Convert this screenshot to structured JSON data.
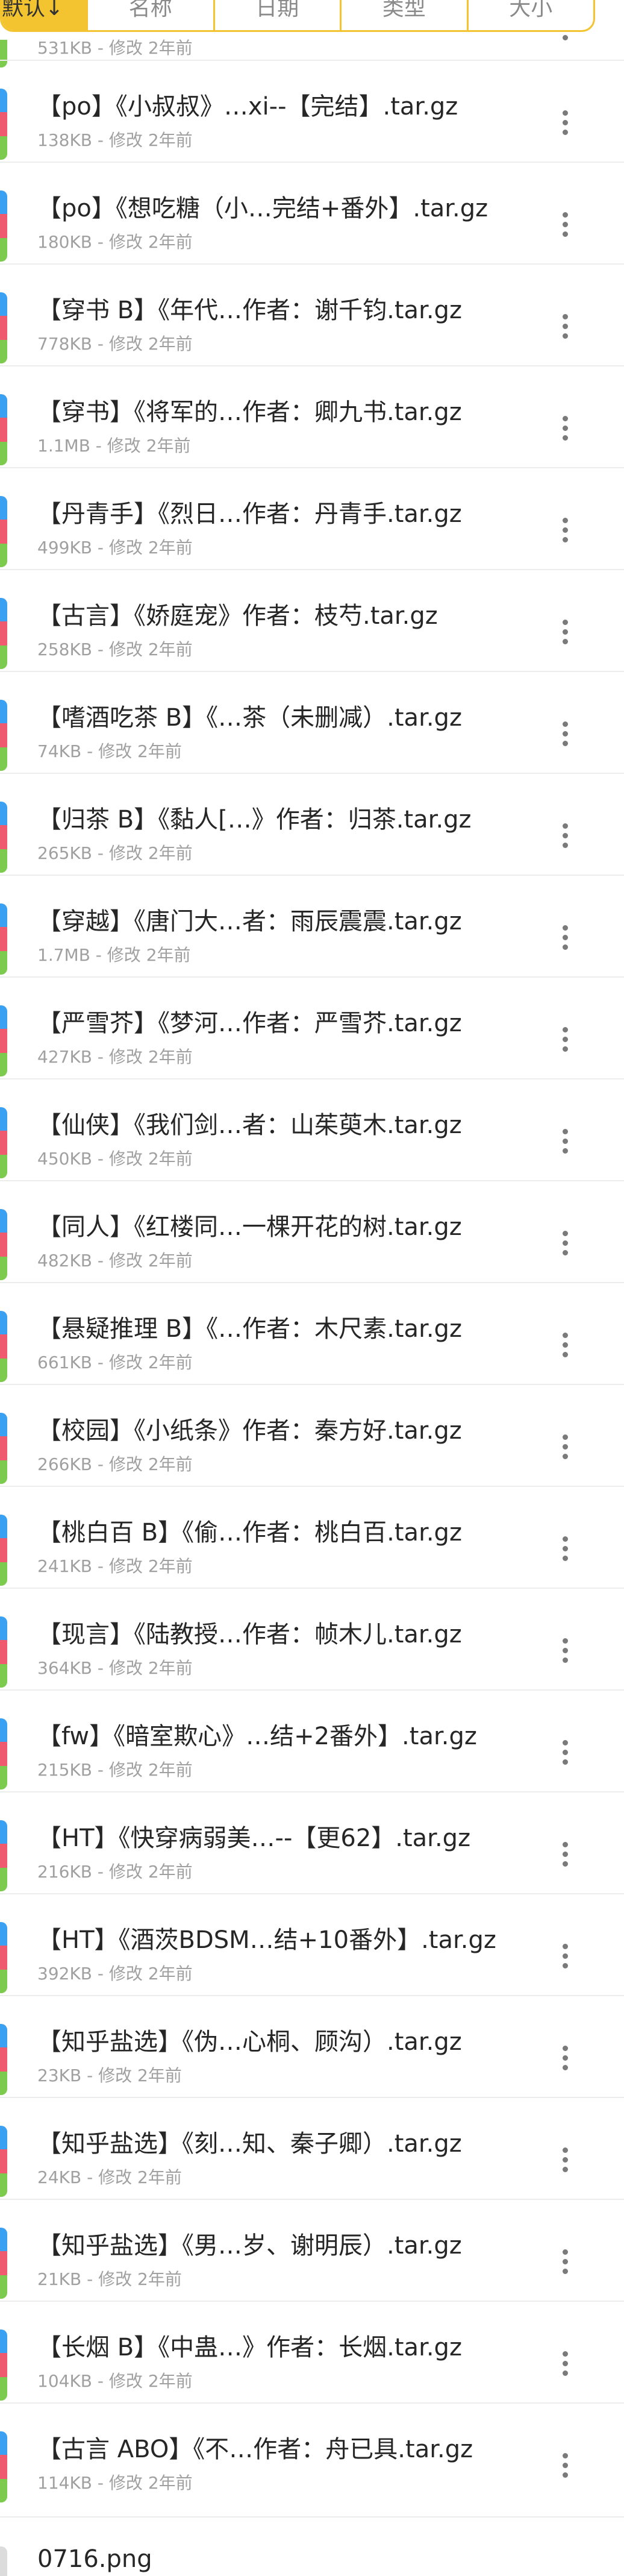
{
  "sort_tabs": [
    {
      "label": "默认↓",
      "active": true
    },
    {
      "label": "名称",
      "active": false
    },
    {
      "label": "日期",
      "active": false
    },
    {
      "label": "类型",
      "active": false
    },
    {
      "label": "大小",
      "active": false
    }
  ],
  "partial_top_item": {
    "meta": "531KB - 修改 2年前"
  },
  "files": [
    {
      "name": "【po】《小叔叔》…xi--【完结】.tar.gz",
      "meta": "138KB - 修改 2年前"
    },
    {
      "name": "【po】《想吃糖（小…完结+番外】.tar.gz",
      "meta": "180KB - 修改 2年前"
    },
    {
      "name": "【穿书 B】《年代…作者：谢千钧.tar.gz",
      "meta": "778KB - 修改 2年前"
    },
    {
      "name": "【穿书】《将军的…作者：卿九书.tar.gz",
      "meta": "1.1MB - 修改 2年前"
    },
    {
      "name": "【丹青手】《烈日…作者：丹青手.tar.gz",
      "meta": "499KB - 修改 2年前"
    },
    {
      "name": "【古言】《娇庭宠》作者：枝芍.tar.gz",
      "meta": "258KB - 修改 2年前"
    },
    {
      "name": "【嗜酒吃茶 B】《…茶（未删减）.tar.gz",
      "meta": "74KB - 修改 2年前"
    },
    {
      "name": "【归茶 B】《黏人[…》作者：归茶.tar.gz",
      "meta": "265KB - 修改 2年前"
    },
    {
      "name": "【穿越】《唐门大…者：雨辰震震.tar.gz",
      "meta": "1.7MB - 修改 2年前"
    },
    {
      "name": "【严雪芥】《梦河…作者：严雪芥.tar.gz",
      "meta": "427KB - 修改 2年前"
    },
    {
      "name": "【仙侠】《我们剑…者：山茱萸木.tar.gz",
      "meta": "450KB - 修改 2年前"
    },
    {
      "name": "【同人】《红楼同…一棵开花的树.tar.gz",
      "meta": "482KB - 修改 2年前"
    },
    {
      "name": "【悬疑推理 B】《…作者：木尺素.tar.gz",
      "meta": "661KB - 修改 2年前"
    },
    {
      "name": "【校园】《小纸条》作者：秦方好.tar.gz",
      "meta": "266KB - 修改 2年前"
    },
    {
      "name": "【桃白百 B】《偷…作者：桃白百.tar.gz",
      "meta": "241KB - 修改 2年前"
    },
    {
      "name": "【现言】《陆教授…作者：帧木儿.tar.gz",
      "meta": "364KB - 修改 2年前"
    },
    {
      "name": "【fw】《暗室欺心》…结+2番外】.tar.gz",
      "meta": "215KB - 修改 2年前"
    },
    {
      "name": "【HT】《快穿病弱美…--【更62】.tar.gz",
      "meta": "216KB - 修改 2年前"
    },
    {
      "name": "【HT】《酒茨BDSM…结+10番外】.tar.gz",
      "meta": "392KB - 修改 2年前"
    },
    {
      "name": "【知乎盐选】《伪…心桐、顾沟）.tar.gz",
      "meta": "23KB - 修改 2年前"
    },
    {
      "name": "【知乎盐选】《刻…知、秦子卿）.tar.gz",
      "meta": "24KB - 修改 2年前"
    },
    {
      "name": "【知乎盐选】《男…岁、谢明辰）.tar.gz",
      "meta": "21KB - 修改 2年前"
    },
    {
      "name": "【长烟 B】《中蛊…》作者：长烟.tar.gz",
      "meta": "104KB - 修改 2年前"
    },
    {
      "name": "【古言 ABO】《不…作者：舟已具.tar.gz",
      "meta": "114KB - 修改 2年前"
    }
  ],
  "partial_bottom_item": {
    "name": "0716.png"
  },
  "icons": {
    "file": "archive-file-icon",
    "more": "more-vertical-icon",
    "image": "image-file-icon"
  },
  "colors": {
    "accent": "#f4c430",
    "icon_blue": "#3aa0f2",
    "icon_red": "#f05a6e",
    "icon_green": "#7ccb4e"
  }
}
